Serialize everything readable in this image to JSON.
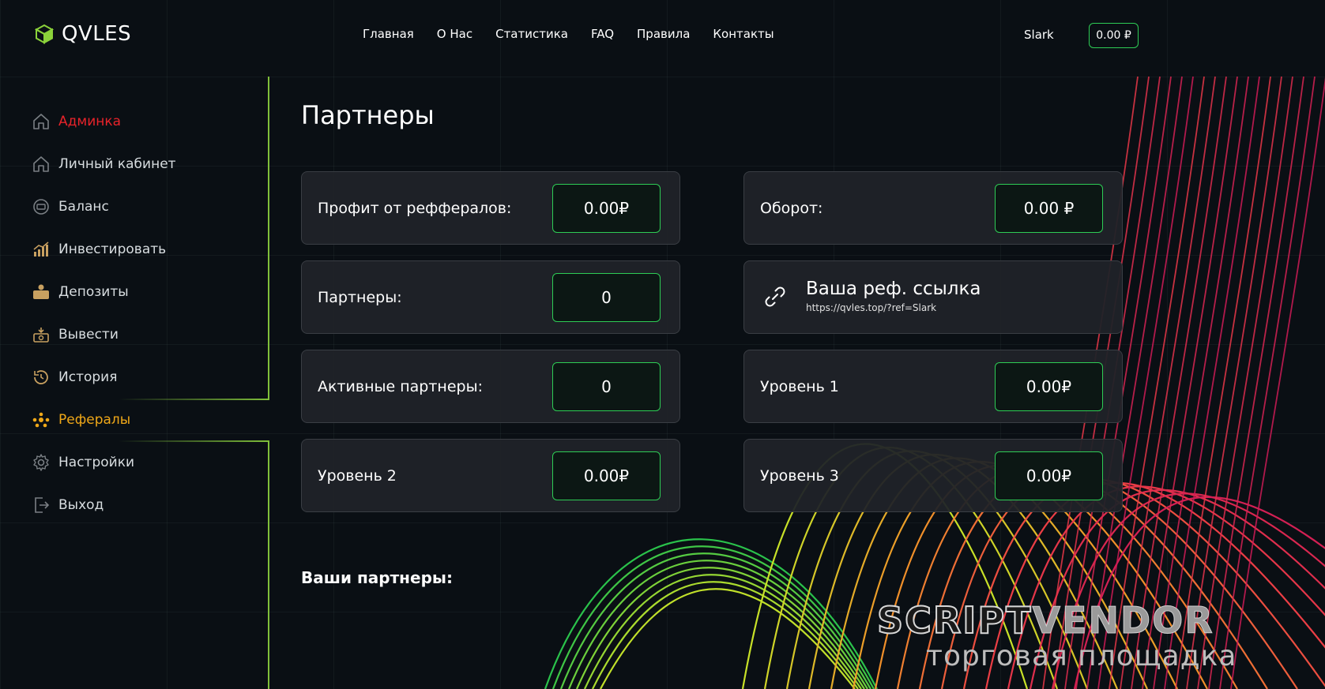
{
  "header": {
    "logo_text": "QVLES",
    "nav": [
      "Главная",
      "О Нас",
      "Статистика",
      "FAQ",
      "Правила",
      "Контакты"
    ],
    "user_name": "Slark",
    "balance": "0.00 ₽"
  },
  "sidebar": {
    "items": [
      {
        "label": "Админка",
        "icon": "home-icon"
      },
      {
        "label": "Личный кабинет",
        "icon": "home-icon"
      },
      {
        "label": "Баланс",
        "icon": "wallet-icon"
      },
      {
        "label": "Инвестировать",
        "icon": "chart-icon"
      },
      {
        "label": "Депозиты",
        "icon": "deposit-icon"
      },
      {
        "label": "Вывести",
        "icon": "withdraw-icon"
      },
      {
        "label": "История",
        "icon": "history-icon"
      },
      {
        "label": "Рефералы",
        "icon": "referrals-icon"
      },
      {
        "label": "Настройки",
        "icon": "gear-icon"
      },
      {
        "label": "Выход",
        "icon": "logout-icon"
      }
    ]
  },
  "main": {
    "title": "Партнеры",
    "cards": {
      "profit": {
        "label": "Профит от реффералов:",
        "value": "0.00₽"
      },
      "turnover": {
        "label": "Оборот:",
        "value": "0.00 ₽"
      },
      "partners": {
        "label": "Партнеры:",
        "value": "0"
      },
      "ref_link": {
        "title": "Ваша реф. ссылка",
        "url": "https://qvles.top/?ref=Slark"
      },
      "active_partners": {
        "label": "Активные партнеры:",
        "value": "0"
      },
      "level1": {
        "label": "Уровень 1",
        "value": "0.00₽"
      },
      "level2": {
        "label": "Уровень 2",
        "value": "0.00₽"
      },
      "level3": {
        "label": "Уровень 3",
        "value": "0.00₽"
      }
    },
    "partners_title": "Ваши партнеры:"
  },
  "watermark": {
    "brand_part1": "SCRIPT",
    "brand_part2": "VENDOR",
    "subtitle": "торговая площадка"
  },
  "colors": {
    "accent_green": "#2ecc55",
    "sidebar_line": "#7fbf3a",
    "admin_red": "#e8232a",
    "referrals_orange": "#f0a818",
    "card_bg": "#202328"
  }
}
